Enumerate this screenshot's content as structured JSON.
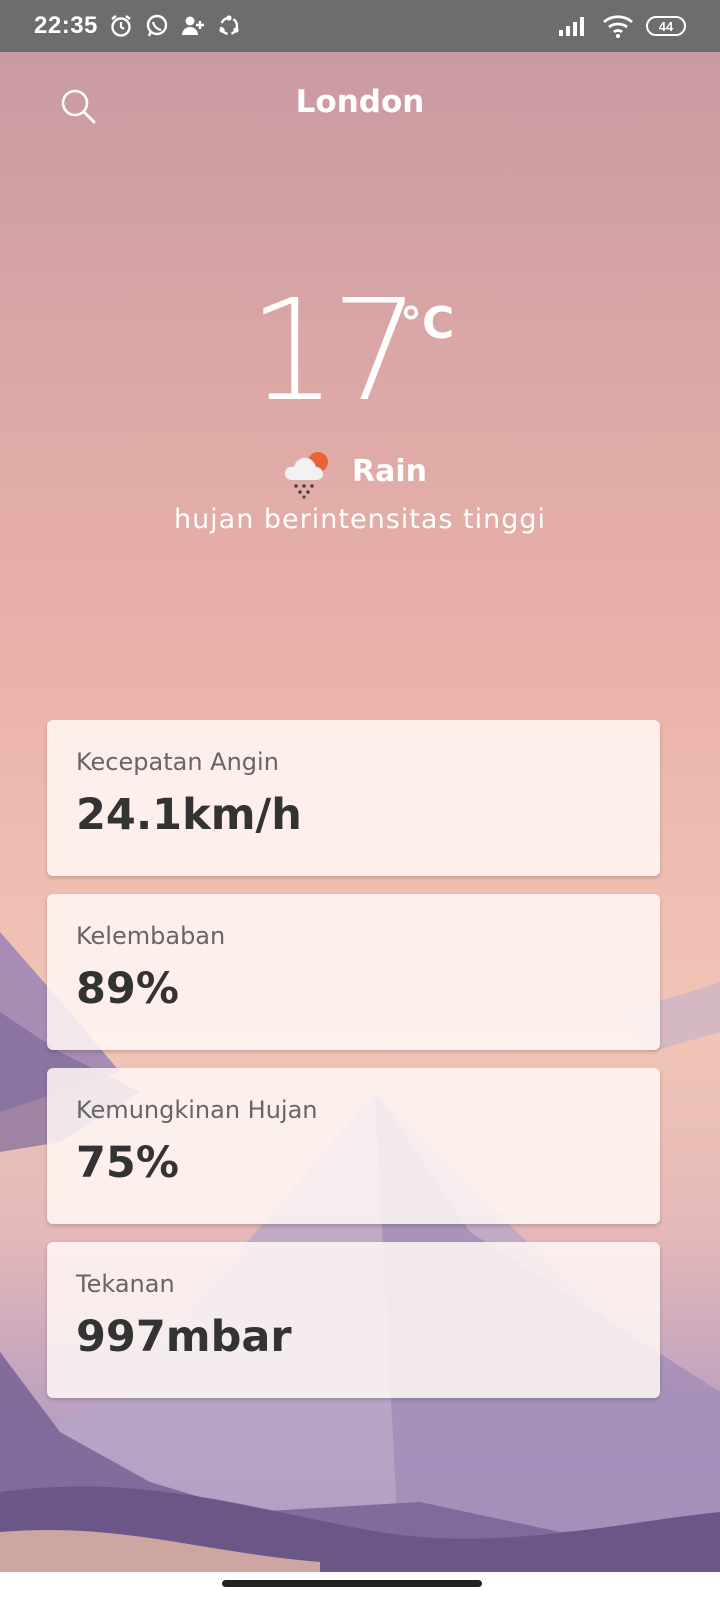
{
  "status_bar": {
    "time": "22:35",
    "battery": "44",
    "left_icons": [
      "alarm-icon",
      "whatsapp-icon",
      "person-add-icon",
      "sync-icon"
    ],
    "right_icons": [
      "signal-icon",
      "wifi-icon",
      "battery-icon"
    ]
  },
  "header": {
    "city": "London",
    "search_icon": "search-icon"
  },
  "weather": {
    "temperature": "17",
    "unit": "°C",
    "condition": "Rain",
    "condition_icon": "rain-cloud-sun-icon",
    "description": "hujan berintensitas tinggi"
  },
  "stats": [
    {
      "label": "Kecepatan Angin",
      "value": "24.1km/h"
    },
    {
      "label": "Kelembaban",
      "value": "89%"
    },
    {
      "label": "Kemungkinan Hujan",
      "value": "75%"
    },
    {
      "label": "Tekanan",
      "value": "997mbar"
    }
  ],
  "colors": {
    "status_bar": "#6d6d6d",
    "sky_top": "#c99aa1",
    "sky_mid": "#efbcb0",
    "mountain": "#8d74a3",
    "card_bg": "#fff8f6",
    "card_value": "#333333",
    "card_label": "#666666"
  }
}
